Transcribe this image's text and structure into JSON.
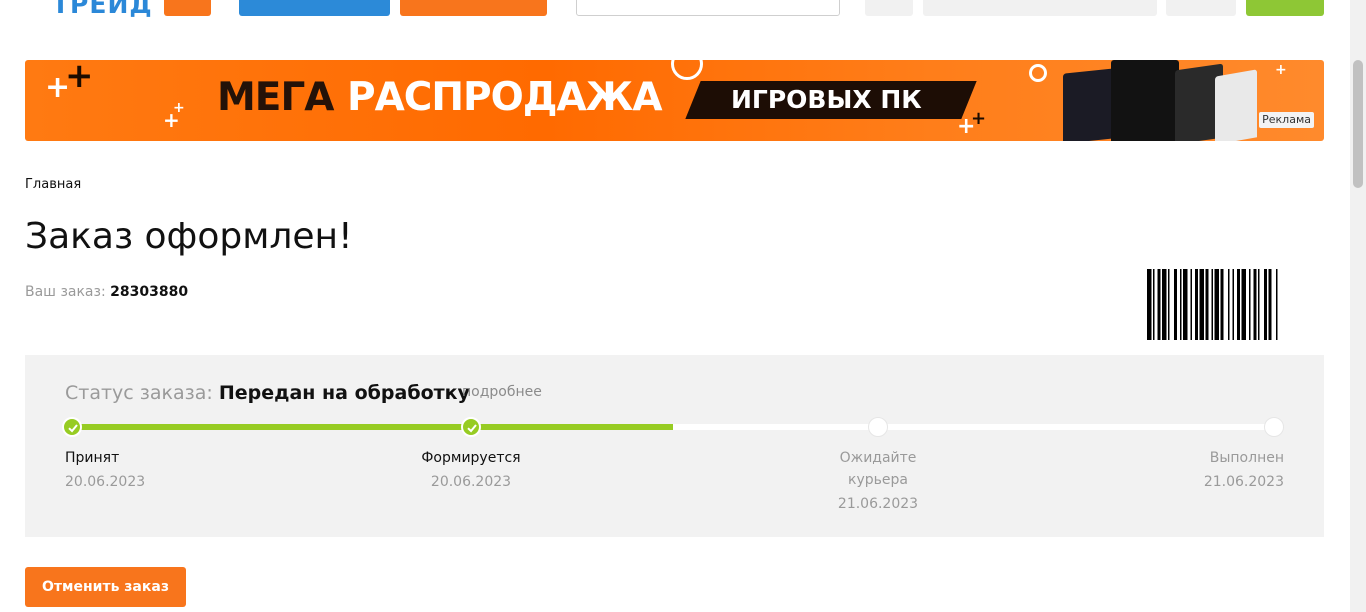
{
  "header": {
    "logo_text": "ТРЕЙД"
  },
  "banner": {
    "title_part1": "МЕГА",
    "title_part2": "РАСПРОДАЖА",
    "tag": "ИГРОВЫХ ПК",
    "ad_label": "Реклама"
  },
  "breadcrumb": {
    "home": "Главная"
  },
  "page": {
    "title": "Заказ оформлен!",
    "order_label": "Ваш заказ:",
    "order_number": "28303880"
  },
  "status": {
    "label": "Статус заказа:",
    "value": "Передан на обработку",
    "more_link": "подробнее",
    "progress_fraction": 0.5,
    "steps": [
      {
        "label": "Принят",
        "date": "20.06.2023",
        "done": true
      },
      {
        "label": "Формируется",
        "date": "20.06.2023",
        "done": true
      },
      {
        "label": "Ожидайте курьера",
        "date": "21.06.2023",
        "done": false
      },
      {
        "label": "Выполнен",
        "date": "21.06.2023",
        "done": false
      }
    ]
  },
  "actions": {
    "cancel_label": "Отменить заказ"
  },
  "colors": {
    "brand_orange": "#f8751c",
    "brand_blue": "#2c8ad8",
    "progress_green": "#97cc23",
    "panel_bg": "#f2f2f2"
  }
}
